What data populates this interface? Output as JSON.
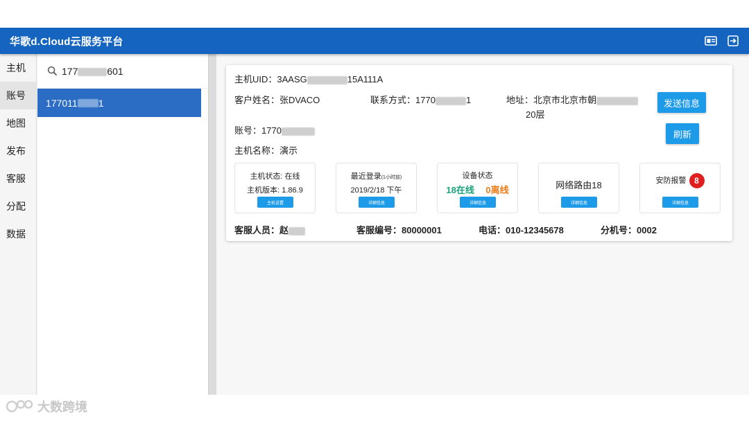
{
  "app": {
    "title": "华歌d.Cloud云服务平台"
  },
  "nav": {
    "items": [
      "主机",
      "账号",
      "地图",
      "发布",
      "客服",
      "分配",
      "数据"
    ],
    "active_index": 1
  },
  "search": {
    "value_prefix": "177",
    "value_suffix": "601"
  },
  "list": {
    "items": [
      {
        "prefix": "177011",
        "suffix": "1"
      }
    ]
  },
  "host": {
    "uid_label": "主机UID：",
    "uid_prefix": "3AASG",
    "uid_suffix": "15A111A",
    "customer_label": "客户姓名：",
    "customer_value": "张DVACO",
    "contact_label": "联系方式：",
    "contact_prefix": "1770",
    "contact_suffix": "1",
    "address_label": "地址：",
    "address_line1": "北京市北京市朝",
    "address_line2": "20层",
    "account_label": "账号：",
    "account_prefix": "1770",
    "name_label": "主机名称：",
    "name_value": "演示"
  },
  "buttons": {
    "send_info": "发送信息",
    "refresh": "刷新"
  },
  "tiles": {
    "host_status": {
      "line1": "主机状态: 在线",
      "line2": "主机版本: 1.86.9",
      "button": "主机设置"
    },
    "last_login": {
      "line1": "最近登录",
      "line1_note": "(1小时前)",
      "line2": "2019/2/18 下午",
      "button": "详细信息"
    },
    "device_status": {
      "title": "设备状态",
      "online": "18在线",
      "offline": "0离线",
      "button": "详细信息"
    },
    "network": {
      "title": "网络路由18",
      "button": "详细信息"
    },
    "security": {
      "title": "安防报警",
      "badge": "8",
      "button": "详细信息"
    }
  },
  "service": {
    "staff_label": "客服人员：",
    "staff_prefix": "赵",
    "id_label": "客服编号：",
    "id_value": "80000001",
    "phone_label": "电话：",
    "phone_value": "010-12345678",
    "ext_label": "分机号：",
    "ext_value": "0002"
  },
  "watermark": {
    "text": "大数跨境"
  },
  "colors": {
    "titlebar": "#1565c0",
    "selected": "#2b6cc4",
    "button": "#1e9be8",
    "online": "#1aa37a",
    "offline": "#f07d1a",
    "alert": "#e02020"
  }
}
